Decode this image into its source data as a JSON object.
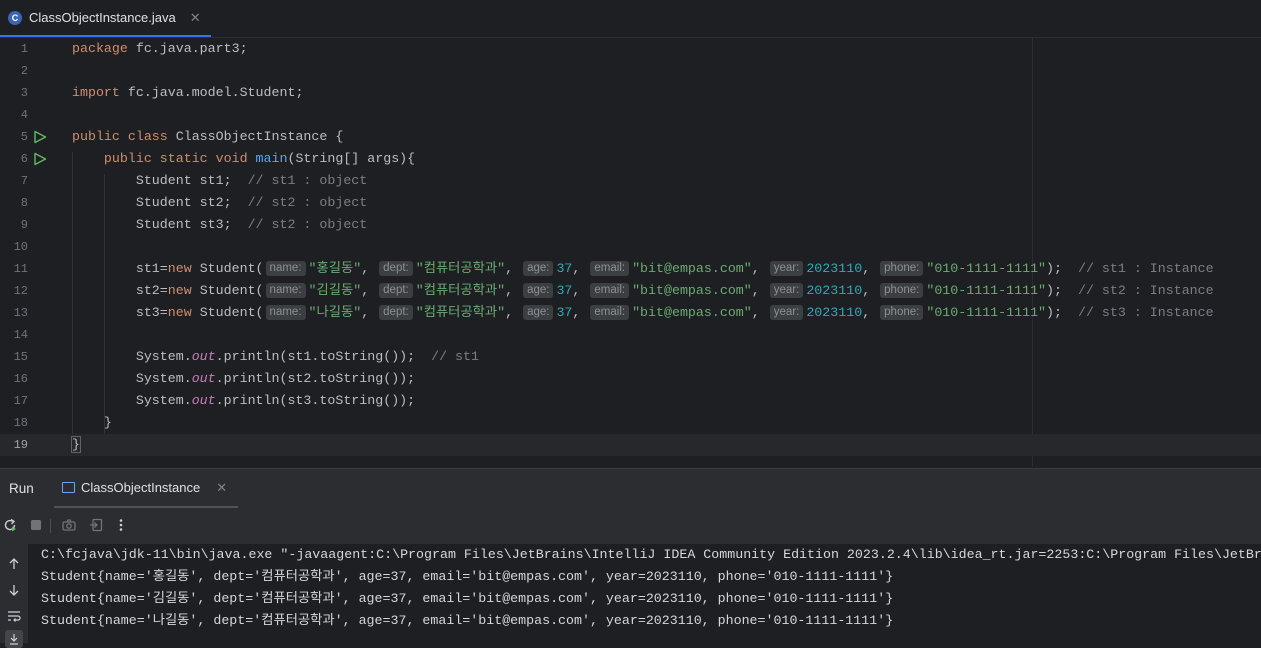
{
  "tab": {
    "label": "ClassObjectInstance.java",
    "icon_glyph": "C"
  },
  "code_lines": [
    {
      "n": "1",
      "text": "package fc.java.part3;"
    },
    {
      "n": "2",
      "text": ""
    },
    {
      "n": "3",
      "text": "import fc.java.model.Student;"
    },
    {
      "n": "4",
      "text": ""
    },
    {
      "n": "5",
      "text": "public class ClassObjectInstance {"
    },
    {
      "n": "6",
      "text": "    public static void main(String[] args){"
    },
    {
      "n": "7",
      "text": "        Student st1;  // st1 : object"
    },
    {
      "n": "8",
      "text": "        Student st2;  // st2 : object"
    },
    {
      "n": "9",
      "text": "        Student st3;  // st2 : object"
    },
    {
      "n": "10",
      "text": ""
    },
    {
      "n": "11",
      "text": "        st1=new Student( name: \"홍길동\",  dept: \"컴퓨터공학과\",  age: 37,  email: \"bit@empas.com\",  year: 2023110,  phone: \"010-1111-1111\");  // st1 : Instance"
    },
    {
      "n": "12",
      "text": "        st2=new Student( name: \"김길동\",  dept: \"컴퓨터공학과\",  age: 37,  email: \"bit@empas.com\",  year: 2023110,  phone: \"010-1111-1111\");  // st2 : Instance"
    },
    {
      "n": "13",
      "text": "        st3=new Student( name: \"나길동\",  dept: \"컴퓨터공학과\",  age: 37,  email: \"bit@empas.com\",  year: 2023110,  phone: \"010-1111-1111\");  // st3 : Instance"
    },
    {
      "n": "14",
      "text": ""
    },
    {
      "n": "15",
      "text": "        System.out.println(st1.toString());  // st1"
    },
    {
      "n": "16",
      "text": "        System.out.println(st2.toString());"
    },
    {
      "n": "17",
      "text": "        System.out.println(st3.toString());"
    },
    {
      "n": "18",
      "text": "    }"
    },
    {
      "n": "19",
      "text": "}"
    }
  ],
  "run_panel": {
    "title": "Run",
    "tab_label": "ClassObjectInstance"
  },
  "console": [
    "C:\\fcjava\\jdk-11\\bin\\java.exe \"-javaagent:C:\\Program Files\\JetBrains\\IntelliJ IDEA Community Edition 2023.2.4\\lib\\idea_rt.jar=2253:C:\\Program Files\\JetBra",
    "Student{name='홍길동', dept='컴퓨터공학과', age=37, email='bit@empas.com', year=2023110, phone='010-1111-1111'}",
    "Student{name='김길동', dept='컴퓨터공학과', age=37, email='bit@empas.com', year=2023110, phone='010-1111-1111'}",
    "Student{name='나길동', dept='컴퓨터공학과', age=37, email='bit@empas.com', year=2023110, phone='010-1111-1111'}"
  ],
  "colors": {
    "keyword": "#cf8e6d",
    "string": "#6aab73",
    "number": "#2aacb8",
    "comment": "#7a7e85",
    "method": "#56a8f5",
    "static_field": "#c77dbb",
    "accent": "#3574f0"
  },
  "icons": [
    "java-class-icon",
    "close-icon",
    "run-gutter-icon",
    "rerun-icon",
    "stop-icon",
    "camera-icon",
    "exit-icon",
    "more-icon",
    "scroll-up-icon",
    "scroll-down-icon",
    "soft-wrap-icon",
    "scroll-end-icon"
  ]
}
